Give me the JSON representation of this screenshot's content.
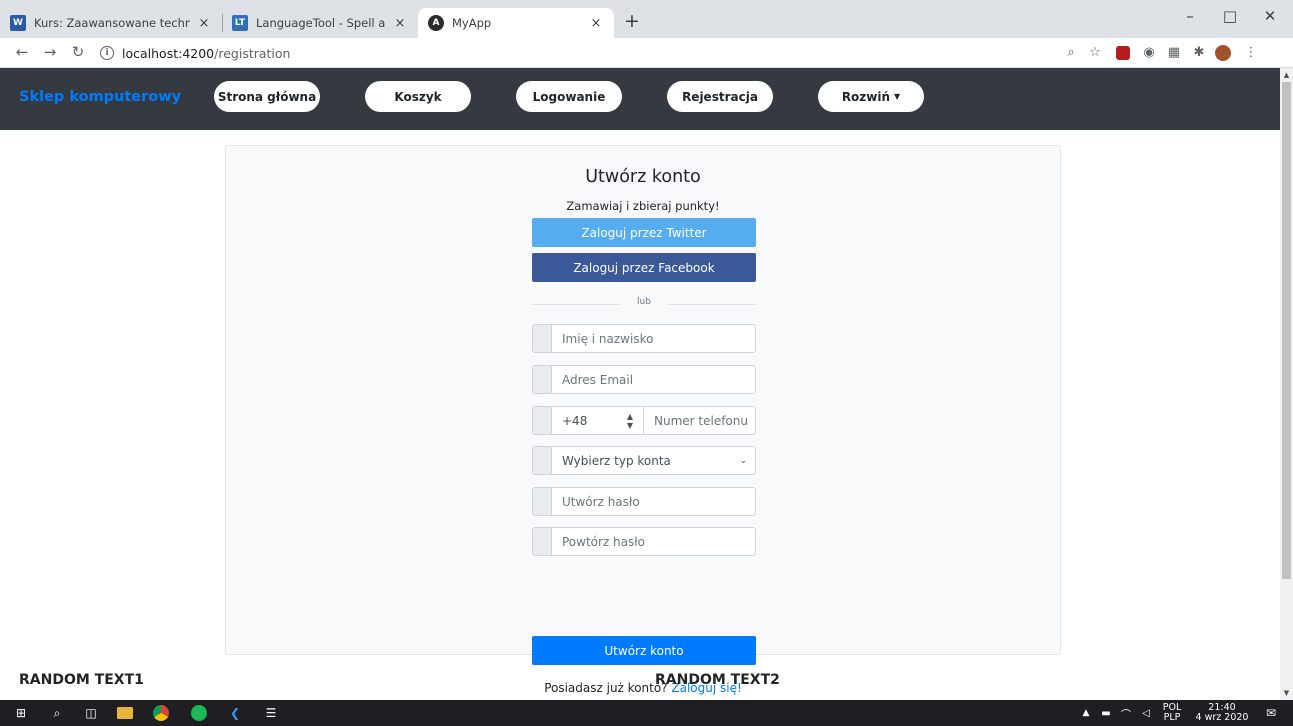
{
  "browser": {
    "tabs": [
      {
        "title": "Kurs: Zaawansowane technologie",
        "favicon": "wsb-icon",
        "close": "×"
      },
      {
        "title": "LanguageTool - Spell and Grammar",
        "favicon": "languagetool-icon",
        "close": "×"
      },
      {
        "title": "MyApp",
        "favicon": "angular-icon",
        "close": "×"
      }
    ],
    "new_tab": "+",
    "url_host": "localhost:4200",
    "url_path": "/registration"
  },
  "app": {
    "brand": "Sklep komputerowy",
    "nav": [
      {
        "label": "Strona główna"
      },
      {
        "label": "Koszyk"
      },
      {
        "label": "Logowanie"
      },
      {
        "label": "Rejestracja"
      },
      {
        "label": "Rozwiń"
      }
    ]
  },
  "form": {
    "title": "Utwórz konto",
    "subtitle": "Zamawiaj i zbieraj punkty!",
    "twitter_button": "Zaloguj przez Twitter",
    "facebook_button": "Zaloguj przez Facebook",
    "divider": "lub",
    "name_placeholder": "Imię i nazwisko",
    "email_placeholder": "Adres Email",
    "phone_prefix": "+48",
    "phone_placeholder": "Numer telefonu",
    "account_type": "Wybierz typ konta",
    "password_placeholder": "Utwórz hasło",
    "repeat_password_placeholder": "Powtórz hasło",
    "submit": "Utwórz konto",
    "have_account": "Posiadasz już konto?",
    "login_link": "Zaloguj się!"
  },
  "footer": {
    "text1": "RANDOM TEXT1",
    "text2": "RANDOM TEXT2"
  },
  "taskbar": {
    "lang_top": "POL",
    "lang_bottom": "PLP",
    "time": "21:40",
    "date": "4 wrz 2020"
  },
  "colors": {
    "navbar": "#343a40",
    "brand": "#007bff",
    "twitter": "#55acee",
    "facebook": "#3b5998",
    "primary": "#007bff"
  }
}
